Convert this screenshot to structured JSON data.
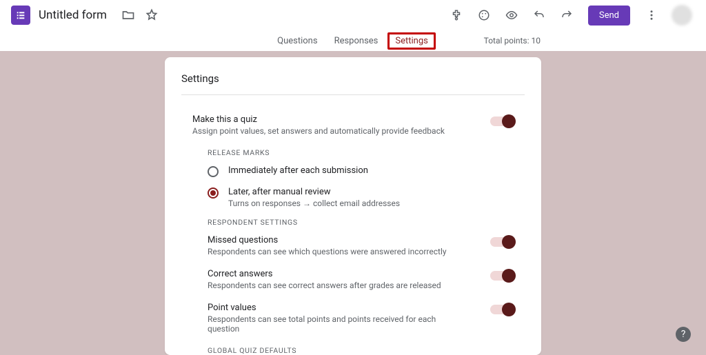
{
  "header": {
    "form_title": "Untitled form",
    "send_label": "Send",
    "total_points_label": "Total points: 10"
  },
  "tabs": {
    "questions": "Questions",
    "responses": "Responses",
    "settings": "Settings"
  },
  "settings": {
    "card_title": "Settings",
    "quiz": {
      "title": "Make this a quiz",
      "sub": "Assign point values, set answers and automatically provide feedback"
    },
    "release_header": "RELEASE MARKS",
    "release_opt1": "Immediately after each submission",
    "release_opt2": {
      "title": "Later, after manual review",
      "sub": "Turns on responses → collect email addresses"
    },
    "respondent_header": "RESPONDENT SETTINGS",
    "missed": {
      "title": "Missed questions",
      "sub": "Respondents can see which questions were answered incorrectly"
    },
    "correct": {
      "title": "Correct answers",
      "sub": "Respondents can see correct answers after grades are released"
    },
    "points": {
      "title": "Point values",
      "sub": "Respondents can see total points and points received for each question"
    },
    "global_header": "GLOBAL QUIZ DEFAULTS"
  },
  "help": "?"
}
